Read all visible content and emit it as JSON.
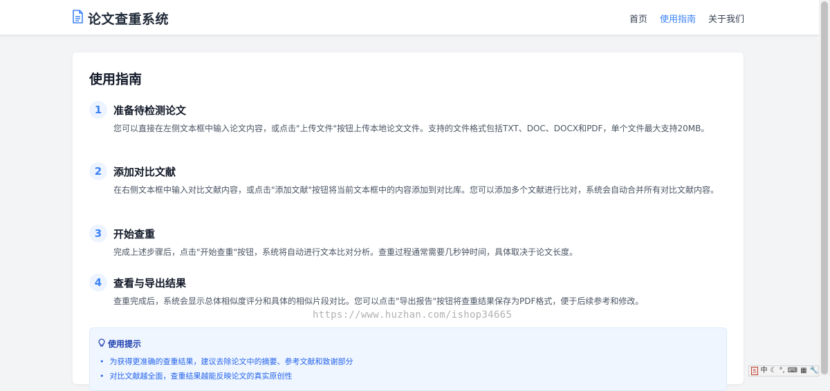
{
  "header": {
    "title": "论文查重系统",
    "nav": [
      {
        "label": "首页",
        "active": false
      },
      {
        "label": "使用指南",
        "active": true
      },
      {
        "label": "关于我们",
        "active": false
      }
    ]
  },
  "guide": {
    "title": "使用指南",
    "steps": [
      {
        "number": "1",
        "title": "准备待检测论文",
        "desc": "您可以直接在左侧文本框中输入论文内容，或点击\"上传文件\"按钮上传本地论文文件。支持的文件格式包括TXT、DOC、DOCX和PDF，单个文件最大支持20MB。"
      },
      {
        "number": "2",
        "title": "添加对比文献",
        "desc": "在右侧文本框中输入对比文献内容，或点击\"添加文献\"按钮将当前文本框中的内容添加到对比库。您可以添加多个文献进行比对，系统会自动合并所有对比文献内容。"
      },
      {
        "number": "3",
        "title": "开始查重",
        "desc": "完成上述步骤后，点击\"开始查重\"按钮，系统将自动进行文本比对分析。查重过程通常需要几秒钟时间，具体取决于论文长度。"
      },
      {
        "number": "4",
        "title": "查看与导出结果",
        "desc": "查重完成后，系统会显示总体相似度评分和具体的相似片段对比。您可以点击\"导出报告\"按钮将查重结果保存为PDF格式，便于后续参考和修改。"
      }
    ],
    "tips": {
      "title": "使用提示",
      "items": [
        "为获得更准确的查重结果，建议去除论文中的摘要、参考文献和致谢部分",
        "对比文献越全面，查重结果越能反映论文的真实原创性"
      ]
    }
  },
  "watermark": "https://www.huzhan.com/ishop34665",
  "ime": {
    "lang": "中",
    "moon": "☾",
    "punct": "°,",
    "keyboard": "⌨",
    "grid": "▦",
    "tool": "🔧"
  },
  "colors": {
    "accent": "#3b82f6",
    "tip_bg": "#eff6ff",
    "tip_text": "#2563eb"
  }
}
